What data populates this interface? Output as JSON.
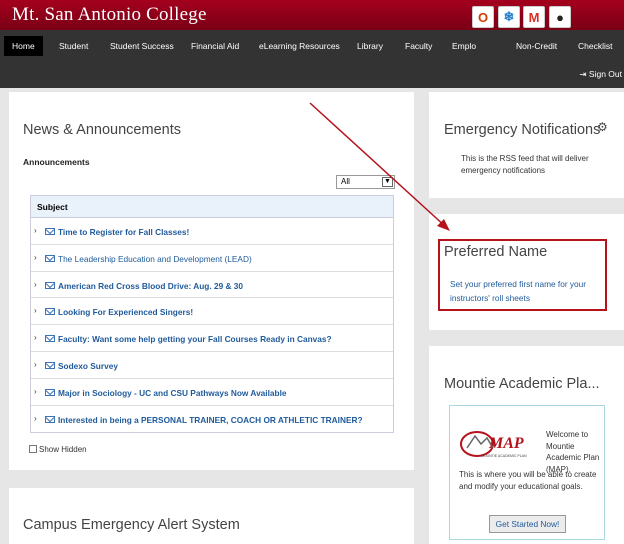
{
  "header": {
    "logo": "Mt. San Antonio College",
    "apps": [
      {
        "icon": "office-icon",
        "glyph": "O",
        "color": "#d83b01"
      },
      {
        "icon": "snowflake-icon",
        "glyph": "❄",
        "color": "#2a7fc9"
      },
      {
        "icon": "gmail-icon",
        "glyph": "M",
        "color": "#d93025"
      },
      {
        "icon": "globe-icon",
        "glyph": "●",
        "color": "#222222"
      },
      {
        "icon": "user-icon",
        "glyph": "▢",
        "color": "#cccccc"
      }
    ]
  },
  "nav": {
    "items": [
      "Home",
      "Student",
      "Student Success",
      "Financial Aid",
      "eLearning Resources",
      "Library",
      "Faculty",
      "Emplo",
      "Non-Credit",
      "Checklist"
    ],
    "signout": "Sign Out",
    "signout_icon": "sign-out-icon"
  },
  "news": {
    "title": "News & Announcements",
    "section_label": "Announcements",
    "filter_value": "All",
    "column_header": "Subject",
    "rows": [
      {
        "text": "Time to Register for Fall Classes!",
        "bold": true,
        "icon": "mail-icon"
      },
      {
        "text": "The Leadership Education and Development (LEAD)",
        "bold": false,
        "icon": "mail-open-icon"
      },
      {
        "text": "American Red Cross Blood Drive: Aug. 29 & 30",
        "bold": true,
        "icon": "mail-icon"
      },
      {
        "text": "Looking For Experienced Singers!",
        "bold": true,
        "icon": "mail-icon"
      },
      {
        "text": "Faculty: Want some help getting your Fall Courses Ready in Canvas?",
        "bold": true,
        "icon": "mail-icon"
      },
      {
        "text": "Sodexo Survey",
        "bold": true,
        "icon": "mail-icon"
      },
      {
        "text": "Major in Sociology - UC and CSU Pathways Now Available",
        "bold": true,
        "icon": "mail-icon"
      },
      {
        "text": "Interested in being a PERSONAL TRAINER, COACH OR ATHLETIC TRAINER?",
        "bold": true,
        "icon": "mail-icon"
      }
    ],
    "show_hidden": "Show Hidden"
  },
  "campus_alert": {
    "title": "Campus Emergency Alert System"
  },
  "emergency": {
    "title": "Emergency Notifications",
    "text": "This is the RSS feed that will deliver emergency notifications",
    "settings_icon": "gear-icon"
  },
  "preferred": {
    "title": "Preferred Name",
    "link": "Set your preferred first name for your instructors' roll sheets",
    "highlight_color": "#b5121b"
  },
  "mountie": {
    "title": "Mountie Academic Pla...",
    "logo_text": "MAP",
    "logo_subtext": "MOUNTIE ACADEMIC PLAN",
    "welcome": "Welcome to Mountie Academic Plan (MAP).",
    "description": "This is where you will be able to create and modify your educational goals.",
    "button": "Get Started Now!"
  },
  "colors": {
    "brand": "#a4001d",
    "nav": "#333333",
    "link": "#1f5a9b",
    "annotation_arrow": "#b5121b"
  }
}
